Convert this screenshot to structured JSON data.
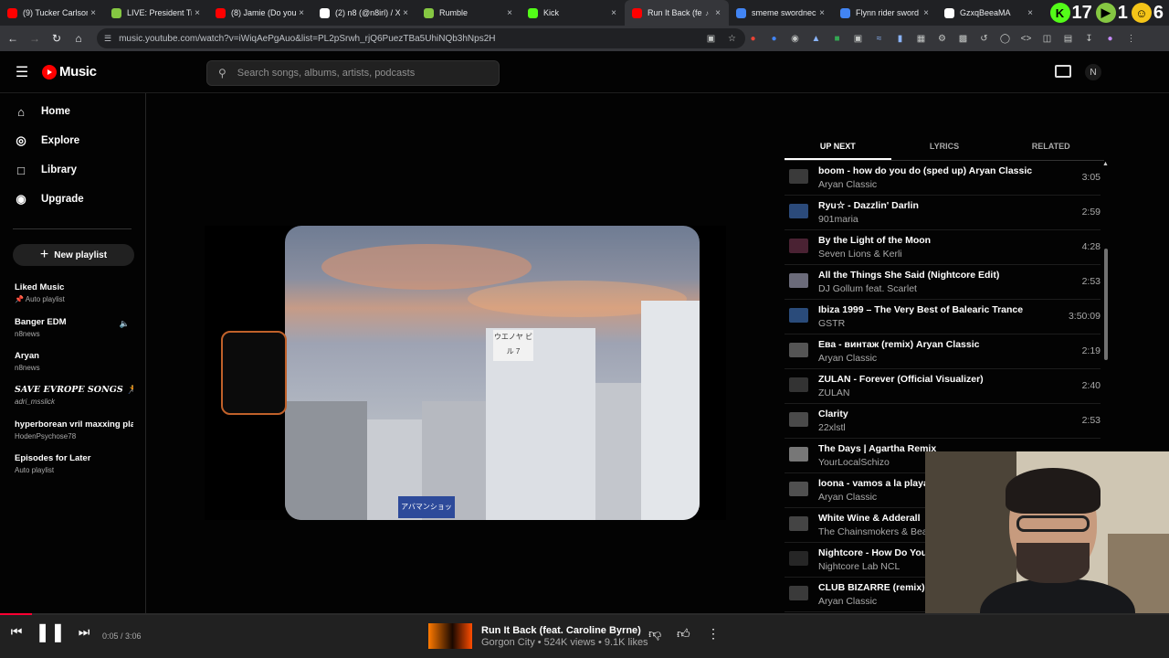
{
  "browser": {
    "tabs": [
      {
        "title": "(9) Tucker Carlson",
        "icon": "youtube-icon",
        "color": "#ff0000"
      },
      {
        "title": "LIVE: President Tru",
        "icon": "rumble-icon",
        "color": "#85c742"
      },
      {
        "title": "(8) Jamie (Do you",
        "icon": "youtube-icon",
        "color": "#ff0000"
      },
      {
        "title": "(2) n8 (@n8irl) / X",
        "icon": "x-icon",
        "color": "#ffffff"
      },
      {
        "title": "Rumble",
        "icon": "rumble-icon",
        "color": "#85c742"
      },
      {
        "title": "Kick",
        "icon": "kick-icon",
        "color": "#53fc18"
      },
      {
        "title": "Run It Back (fe",
        "icon": "ytmusic-icon",
        "color": "#ff0000",
        "active": true
      },
      {
        "title": "smeme swordneck",
        "icon": "google-icon",
        "color": "#4285f4"
      },
      {
        "title": "Flynn rider sword",
        "icon": "google-icon",
        "color": "#4285f4"
      },
      {
        "title": "GzxqBeeaMA",
        "icon": "x-icon",
        "color": "#ffffff"
      }
    ],
    "badges": [
      {
        "value": "17",
        "icon": "kick-icon",
        "color": "#53fc18"
      },
      {
        "value": "1",
        "icon": "rumble-play-icon",
        "color": "#85c742"
      },
      {
        "value": "6",
        "icon": "emoji-icon",
        "color": "#f5c518"
      }
    ],
    "url": "music.youtube.com/watch?v=iWiqAePgAuo&list=PL2pSrwh_rjQ6PuezTBa5UhiNQb3hNps2H"
  },
  "header": {
    "logo_text": "Music",
    "search_placeholder": "Search songs, albums, artists, podcasts",
    "avatar_letter": "N"
  },
  "sidebar": {
    "nav": [
      {
        "label": "Home",
        "icon": "home-icon"
      },
      {
        "label": "Explore",
        "icon": "explore-icon"
      },
      {
        "label": "Library",
        "icon": "library-icon"
      },
      {
        "label": "Upgrade",
        "icon": "upgrade-icon"
      }
    ],
    "new_playlist": "New playlist",
    "playlists": [
      {
        "title": "Liked Music",
        "subtitle": "📌 Auto playlist"
      },
      {
        "title": "Banger EDM",
        "subtitle": "n8news",
        "playing": true
      },
      {
        "title": "Aryan",
        "subtitle": "n8news"
      },
      {
        "title": "SAVE EVROPE SONGS 🏃 ...",
        "subtitle": "adri_msslick"
      },
      {
        "title": "hyperborean vril maxxing pla...",
        "subtitle": "HodenPsychose78"
      },
      {
        "title": "Episodes for Later",
        "subtitle": "Auto playlist"
      }
    ]
  },
  "video": {
    "sign_text": "アバマンショップ",
    "building_sign": "ウエノヤ ビル 7"
  },
  "panel": {
    "tabs": [
      "UP NEXT",
      "LYRICS",
      "RELATED"
    ],
    "queue": [
      {
        "title": "boom - how do you do (sped up) Aryan Classic",
        "artist": "Aryan Classic",
        "duration": "3:05"
      },
      {
        "title": "Ryu☆ - Dazzlin' Darlin",
        "artist": "901maria",
        "duration": "2:59"
      },
      {
        "title": "By the Light of the Moon",
        "artist": "Seven Lions & Kerli",
        "duration": "4:28"
      },
      {
        "title": "All the Things She Said (Nightcore Edit)",
        "artist": "DJ Gollum feat. Scarlet",
        "duration": "2:53"
      },
      {
        "title": "Ibiza 1999 – The Very Best of Balearic Trance",
        "artist": "GSTR",
        "duration": "3:50:09"
      },
      {
        "title": "Ева - винтаж (remix) Aryan Classic",
        "artist": "Aryan Classic",
        "duration": "2:19"
      },
      {
        "title": "ZULAN - Forever (Official Visualizer)",
        "artist": "ZULAN",
        "duration": "2:40"
      },
      {
        "title": "Clarity",
        "artist": "22xlstl",
        "duration": "2:53"
      },
      {
        "title": "The Days | Agartha Remix",
        "artist": "YourLocalSchizo",
        "duration": ""
      },
      {
        "title": "loona - vamos a la playa",
        "artist": "Aryan Classic",
        "duration": ""
      },
      {
        "title": "White Wine & Adderall",
        "artist": "The Chainsmokers & Bea",
        "duration": ""
      },
      {
        "title": "Nightcore - How Do You",
        "artist": "Nightcore Lab NCL",
        "duration": ""
      },
      {
        "title": "CLUB BIZARRE (remix) A",
        "artist": "Aryan Classic",
        "duration": ""
      }
    ]
  },
  "player": {
    "time": "0:05 / 3:06",
    "progress": 0.027,
    "title": "Run It Back (feat. Caroline Byrne)",
    "meta": "Gorgon City • 524K views • 9.1K likes"
  }
}
